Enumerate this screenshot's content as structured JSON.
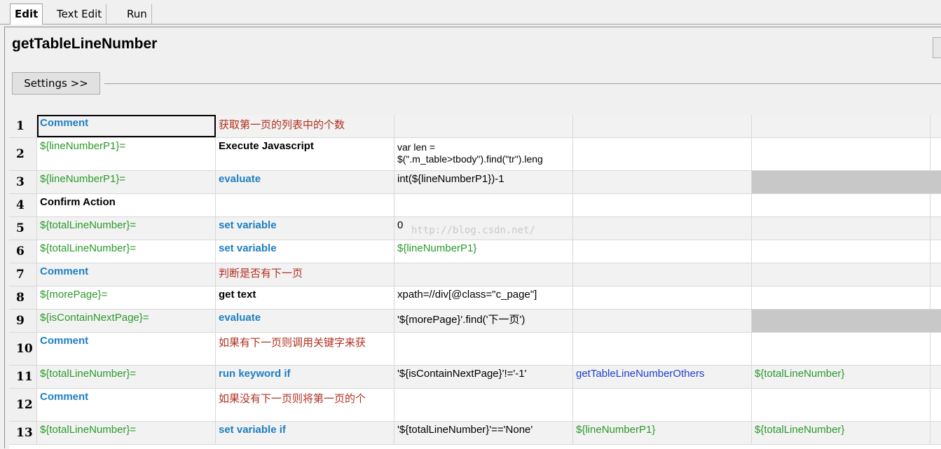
{
  "tabs": [
    {
      "label": "Edit",
      "active": true
    },
    {
      "label": "Text Edit",
      "active": false
    },
    {
      "label": "Run",
      "active": false
    }
  ],
  "title": "getTableLineNumber",
  "settings_label": "Settings >>",
  "watermark": "http://blog.csdn.net/",
  "colors": {
    "comment_blue": "#1e7fc2",
    "variable_green": "#2a9a2a",
    "comment_text_red": "#b03020",
    "keyword_link_blue": "#1f40d0",
    "disabled_cell_grey": "#c8c8c8"
  },
  "rows": [
    {
      "num": "1",
      "c1": "Comment",
      "c2": "获取第一页的列表中的个数",
      "c3": "",
      "c4": "",
      "c5": ""
    },
    {
      "num": "2",
      "c1": "${lineNumberP1}=",
      "c2": "Execute Javascript",
      "c3a": "var len =",
      "c3b": "$(\".m_table>tbody\").find(\"tr\").leng",
      "c4": "",
      "c5": ""
    },
    {
      "num": "3",
      "c1": "${lineNumberP1}=",
      "c2": "evaluate",
      "c3": "int(${lineNumberP1})-1",
      "c4": "",
      "c5": ""
    },
    {
      "num": "4",
      "c1": "Confirm Action",
      "c2": "",
      "c3": "",
      "c4": "",
      "c5": ""
    },
    {
      "num": "5",
      "c1": "${totalLineNumber}=",
      "c2": "set variable",
      "c3": "0",
      "c4": "",
      "c5": ""
    },
    {
      "num": "6",
      "c1": "${totalLineNumber}=",
      "c2": "set variable",
      "c3": "${lineNumberP1}",
      "c4": "",
      "c5": ""
    },
    {
      "num": "7",
      "c1": "Comment",
      "c2": "判断是否有下一页",
      "c3": "",
      "c4": "",
      "c5": ""
    },
    {
      "num": "8",
      "c1": "${morePage}=",
      "c2": "get text",
      "c3": "xpath=//div[@class=\"c_page\"]",
      "c4": "",
      "c5": ""
    },
    {
      "num": "9",
      "c1": "${isContainNextPage}=",
      "c2": "evaluate",
      "c3": "'${morePage}'.find('下一页')",
      "c4": "",
      "c5": ""
    },
    {
      "num": "10",
      "c1": "Comment",
      "c2": "如果有下一页则调用关键字来获",
      "c3": "",
      "c4": "",
      "c5": ""
    },
    {
      "num": "11",
      "c1": "${totalLineNumber}=",
      "c2": "run keyword if",
      "c3": "'${isContainNextPage}'!='-1'",
      "c4": "getTableLineNumberOthers",
      "c5": "${totalLineNumber}"
    },
    {
      "num": "12",
      "c1": "Comment",
      "c2": "如果没有下一页则将第一页的个",
      "c3": "",
      "c4": "",
      "c5": ""
    },
    {
      "num": "13",
      "c1": "${totalLineNumber}=",
      "c2": "set variable if",
      "c3": "'${totalLineNumber}'=='None'",
      "c4": "${lineNumberP1}",
      "c5": "${totalLineNumber}"
    }
  ]
}
